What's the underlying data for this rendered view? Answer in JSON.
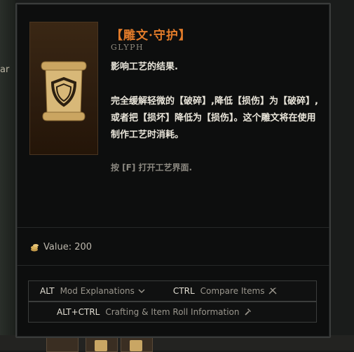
{
  "background": {
    "left_partial_text": "ar"
  },
  "tooltip": {
    "title": "【雕文·守护】",
    "type": "GLYPH",
    "description_1": "影响工艺的结果.",
    "description_2": "完全缓解轻微的【破碎】,降低【损伤】为【破碎】,或者把【损坏】降低为【损伤】。这个雕文将在使用制作工艺时消耗。",
    "hint": "按 [F] 打开工艺界面.",
    "value_label": "Value: 200",
    "keybinds": {
      "alt_key": "ALT",
      "alt_action": "Mod Explanations",
      "ctrl_key": "CTRL",
      "ctrl_action": "Compare Items",
      "altctrl_key": "ALT+CTRL",
      "altctrl_action": "Crafting & Item Roll Information"
    }
  },
  "colors": {
    "title": "#e37c2a",
    "scroll": "#d6b370"
  }
}
